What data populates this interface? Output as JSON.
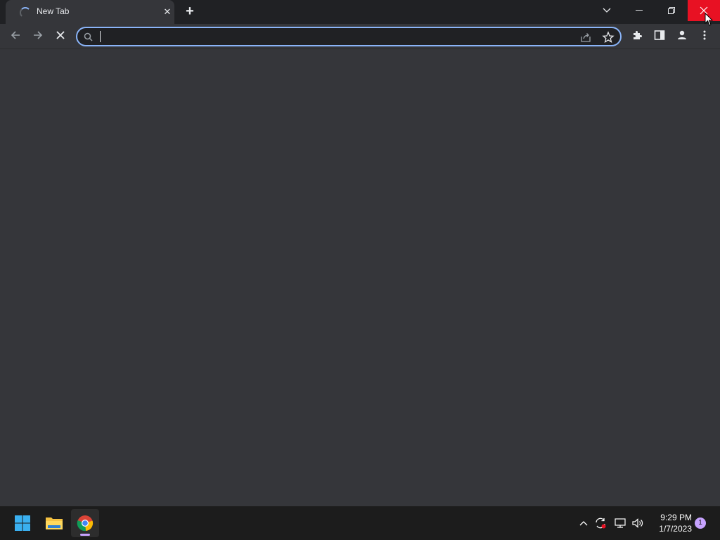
{
  "tab": {
    "title": "New Tab",
    "close": "✕"
  },
  "toolbar": {
    "omnibox_value": ""
  },
  "taskbar": {
    "time": "9:29 PM",
    "date": "1/7/2023",
    "notifications": "1"
  }
}
